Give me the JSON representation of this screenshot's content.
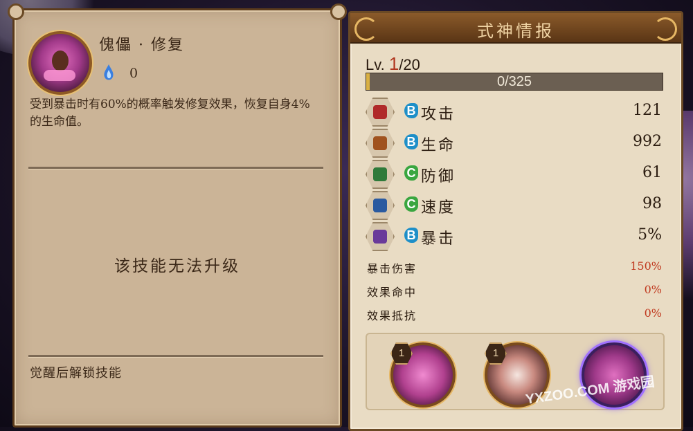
{
  "skill_panel": {
    "name": "傀儡 · 修复",
    "soul_cost": "0",
    "description": "受到暴击时有60%的概率触发修复效果，恢复自身4%的生命值。",
    "upgrade_notice": "该技能无法升级",
    "awaken_notice": "觉醒后解锁技能"
  },
  "info_panel": {
    "title": "式神情报",
    "level_prefix": "Lv.",
    "level_current": "1",
    "level_max": "/20",
    "exp_text": "0/325",
    "exp_fraction": 0.0,
    "stats": [
      {
        "grade": "B",
        "label": "攻击",
        "value": "121",
        "icon": "attack-icon",
        "grade_color": "#1e8fc8",
        "icon_color": "#b02a2a"
      },
      {
        "grade": "B",
        "label": "生命",
        "value": "992",
        "icon": "health-icon",
        "grade_color": "#1e8fc8",
        "icon_color": "#a0521e"
      },
      {
        "grade": "C",
        "label": "防御",
        "value": "61",
        "icon": "defense-icon",
        "grade_color": "#3aa640",
        "icon_color": "#2f7a3a"
      },
      {
        "grade": "C",
        "label": "速度",
        "value": "98",
        "icon": "speed-icon",
        "grade_color": "#3aa640",
        "icon_color": "#2a5aa0"
      },
      {
        "grade": "B",
        "label": "暴击",
        "value": "5%",
        "icon": "crit-icon",
        "grade_color": "#1e8fc8",
        "icon_color": "#6a3a9a"
      }
    ],
    "extra_stats": [
      {
        "label": "暴击伤害",
        "value": "150%"
      },
      {
        "label": "效果命中",
        "value": "0%"
      },
      {
        "label": "效果抵抗",
        "value": "0%"
      }
    ],
    "skills": [
      {
        "level": "1",
        "name": "skill-1"
      },
      {
        "level": "1",
        "name": "skill-2"
      },
      {
        "level": "",
        "name": "skill-3"
      }
    ]
  },
  "watermark": "YXZOO.COM 游戏园"
}
